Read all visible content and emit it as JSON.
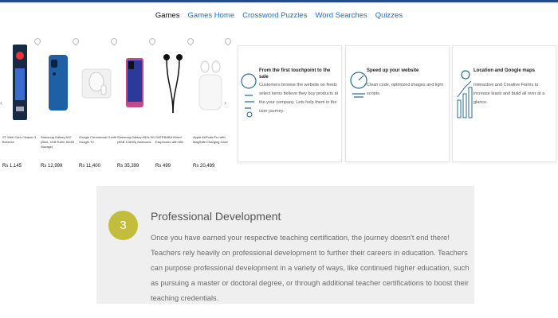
{
  "nav": {
    "items": [
      {
        "label": "Games"
      },
      {
        "label": "Games Home"
      },
      {
        "label": "Crossword Puzzles"
      },
      {
        "label": "Word Searches"
      },
      {
        "label": "Quizzes"
      }
    ],
    "active_index": 0
  },
  "products": [
    {
      "name": "ST Web Cam Cleaner 3 Brushes",
      "price": "Rs 1,145",
      "icon": "cleaner-box-icon"
    },
    {
      "name": "Samsung Galaxy A12 (Blue, 4GB RAM, 64GB Storage)",
      "price": "Rs 12,999",
      "icon": "phone-blue-icon"
    },
    {
      "name": "Google Chromecast 3 with Google TV",
      "price": "Rs 11,400",
      "icon": "chromecast-icon"
    },
    {
      "name": "Samsung Galaxy A52s 5G (8GB 128GB) Awesome",
      "price": "Rs 35,399",
      "icon": "phone-pink-icon"
    },
    {
      "name": "GATEBABA Wired Earphones with Mic",
      "price": "Rs 499",
      "icon": "earphones-icon"
    },
    {
      "name": "Apple AirPods Pro with MagSafe Charging Case",
      "price": "Rs 20,499",
      "icon": "airpods-icon"
    }
  ],
  "cards": [
    {
      "title": "From the first touchpoint to the sale",
      "desc": "Customers browse the website on feeds select items believe they buy products at the your company. Lets help them in the user journey.",
      "icon": "touchpoint-icon"
    },
    {
      "title": "Speed up your website",
      "desc": "Clean code, optimized images and light scripts.",
      "icon": "speed-icon"
    },
    {
      "title": "Location and Google maps",
      "desc": "Interactive and Creative Forms to increase leads and build all over at a glance.",
      "icon": "location-chart-icon"
    }
  ],
  "development": {
    "number": "3",
    "heading": "Professional Development",
    "text": "Once you have earned your respective teaching certification, the journey doesn't end there! Teachers rely heavily on professional development to further their careers in education. Teachers can purpose professional development in a variety of ways, like continued higher education, such as pursuing a master or doctoral degree, or through additional teacher certifications to boost their teaching credentials.",
    "accent": "#c3bd3d"
  },
  "colors": {
    "link": "#1a73c9",
    "topbar": "#1f4e8a"
  }
}
